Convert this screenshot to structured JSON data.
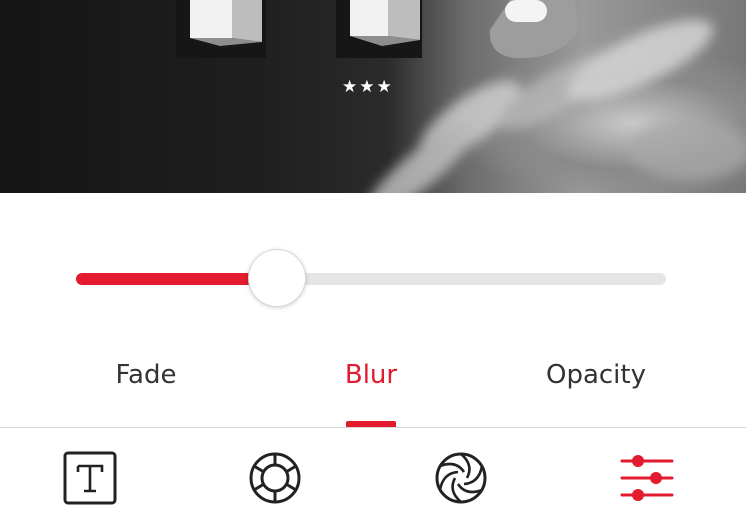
{
  "photo": {
    "rating_stars": "★★★"
  },
  "blur_slider": {
    "value": 0.34
  },
  "tabs": [
    {
      "label": "Fade",
      "active": false
    },
    {
      "label": "Blur",
      "active": true
    },
    {
      "label": "Opacity",
      "active": false
    }
  ],
  "toolbar": {
    "tools": [
      {
        "icon": "text-icon"
      },
      {
        "icon": "lens-filter-icon"
      },
      {
        "icon": "aperture-icon"
      },
      {
        "icon": "adjustments-sliders-icon",
        "active": true
      }
    ]
  },
  "colors": {
    "accent": "#e31b2f",
    "track": "#e3e5e6",
    "text": "#333333",
    "icon": "#222222"
  }
}
